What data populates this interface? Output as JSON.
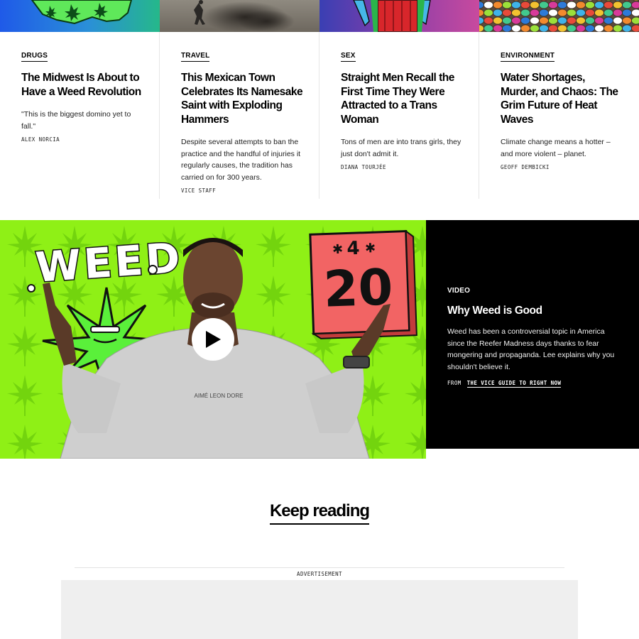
{
  "articles": [
    {
      "category": "DRUGS",
      "headline": "The Midwest Is About to Have a Weed Revolution",
      "dek": "\"This is the biggest domino yet to fall.\"",
      "byline": "ALEX NORCIA"
    },
    {
      "category": "TRAVEL",
      "headline": "This Mexican Town Celebrates Its Namesake Saint with Exploding Hammers",
      "dek": "Despite several attempts to ban the practice and the handful of injuries it regularly causes, the tradition has carried on for 300 years.",
      "byline": "VICE STAFF"
    },
    {
      "category": "SEX",
      "headline": "Straight Men Recall the First Time They Were Attracted to a Trans Woman",
      "dek": "Tons of men are into trans girls, they just don't admit it.",
      "byline": "DIANA TOURJÉE"
    },
    {
      "category": "ENVIRONMENT",
      "headline": "Water Shortages, Murder, and Chaos: The Grim Future of Heat Waves",
      "dek": "Climate change means a hotter – and more violent – planet.",
      "byline": "GEOFF DEMBICKI"
    }
  ],
  "video": {
    "label": "VIDEO",
    "title": "Why Weed is Good",
    "dek": "Weed has been a controversial topic in America since the Reefer Madness days thanks to fear mongering and propaganda. Lee explains why you shouldn't believe it.",
    "from_prefix": "FROM",
    "from_link": "THE VICE GUIDE TO RIGHT NOW",
    "thumb_word": "WEED",
    "thumb_number": "20",
    "thumb_small": "4",
    "shirt_text": "AIMÉ LEON DORE"
  },
  "keep_reading": "Keep reading",
  "advertisement_label": "ADVERTISEMENT",
  "colors": {
    "video_bg": "#8fee14",
    "info_bg": "#000000",
    "ad_bg": "#efefef"
  }
}
